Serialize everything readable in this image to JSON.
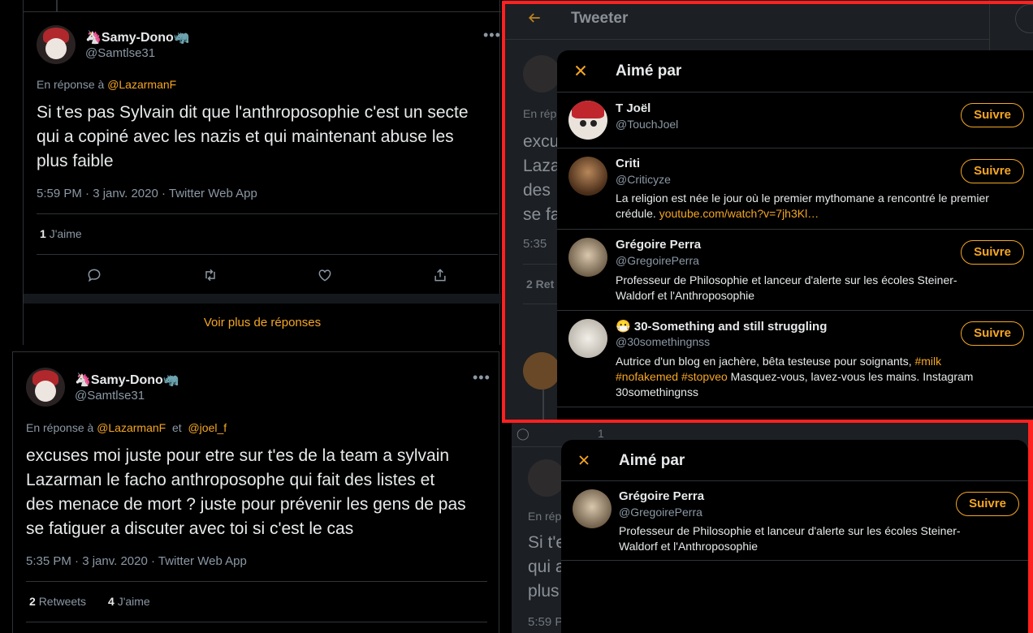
{
  "tweet1": {
    "name": "Samy-Dono",
    "name_prefix": "🦄",
    "name_suffix": "🦏",
    "handle": "@Samtlse31",
    "reply_prefix": "En réponse à",
    "reply_to": "@LazarmanF",
    "text_line1": "Si t'es pas Sylvain dit que l'anthroposophie c'est un secte",
    "text_line2": "qui a copiné avec les nazis et qui maintenant abuse les",
    "text_line3": "plus faible",
    "meta": "5:59 PM · 3 janv. 2020 · Twitter Web App",
    "likes_count": "1",
    "likes_label": "J'aime",
    "more_replies": "Voir plus de réponses"
  },
  "tweet2": {
    "name": "Samy-Dono",
    "name_prefix": "🦄",
    "name_suffix": "🦏",
    "handle": "@Samtlse31",
    "reply_prefix": "En réponse à",
    "reply_to_1": "@LazarmanF",
    "reply_and": "et",
    "reply_to_2": "@joel_f",
    "text_line1": "excuses moi juste pour etre sur t'es de la team a sylvain",
    "text_line2": "Lazarman le facho anthroposophe qui fait des listes et",
    "text_line3": "des menace de mort ? juste pour prévenir les gens de pas",
    "text_line4": "se fatiguer a discuter avec toi si c'est le cas",
    "meta": "5:35 PM · 3 janv. 2020 · Twitter Web App",
    "retweets_count": "2",
    "retweets_label": "Retweets",
    "likes_count": "4",
    "likes_label": "J'aime"
  },
  "background_panel": {
    "header_title": "Tweeter",
    "partial_reply": "En rép",
    "partial_text": [
      "excu",
      "Laza",
      "des",
      "se fa"
    ],
    "partial_time": "5:35",
    "partial_count": "2 Ret",
    "partial_reply2": "En rép",
    "partial_text2": [
      "Si t'e",
      "qui a",
      "plus"
    ],
    "partial_time2": "5:59 P",
    "partial_like_count": "1"
  },
  "modal1": {
    "title": "Aimé par",
    "users": [
      {
        "name": "T Joël",
        "handle": "@TouchJoel",
        "button": "Suivre"
      },
      {
        "name": "Criti",
        "handle": "@Criticyze",
        "button": "Suivre",
        "bio1": "La religion est née le jour où le premier mythomane a rencontré le premier",
        "bio2_text": "crédule.",
        "bio2_link": "youtube.com/watch?v=7jh3Kl…"
      },
      {
        "name": "Grégoire Perra",
        "handle": "@GregoirePerra",
        "button": "Suivre",
        "bio1": "Professeur de Philosophie et lanceur d'alerte sur les écoles Steiner-",
        "bio2": "Waldorf et l'Anthroposophie"
      },
      {
        "name_emoji": "😷",
        "name": "30-Something and still struggling",
        "handle": "@30somethingnss",
        "button": "Suivre",
        "bio1_text": "Autrice d'un blog en jachère, bêta testeuse pour soignants,",
        "bio1_tag": "#milk",
        "bio2_tag1": "#nofakemed",
        "bio2_tag2": "#stopveo",
        "bio2_text": "Masquez-vous, lavez-vous les mains. Instagram",
        "bio3": "30somethingnss"
      }
    ]
  },
  "modal2": {
    "title": "Aimé par",
    "user": {
      "name": "Grégoire Perra",
      "handle": "@GregoirePerra",
      "button": "Suivre",
      "bio1": "Professeur de Philosophie et lanceur d'alerte sur les écoles Steiner-",
      "bio2": "Waldorf et l'Anthroposophie"
    }
  },
  "colors": {
    "accent": "#f5a623",
    "highlight_border": "#ff2020",
    "background": "#000000",
    "modal_bg": "#000000",
    "muted": "#8b98a5"
  }
}
